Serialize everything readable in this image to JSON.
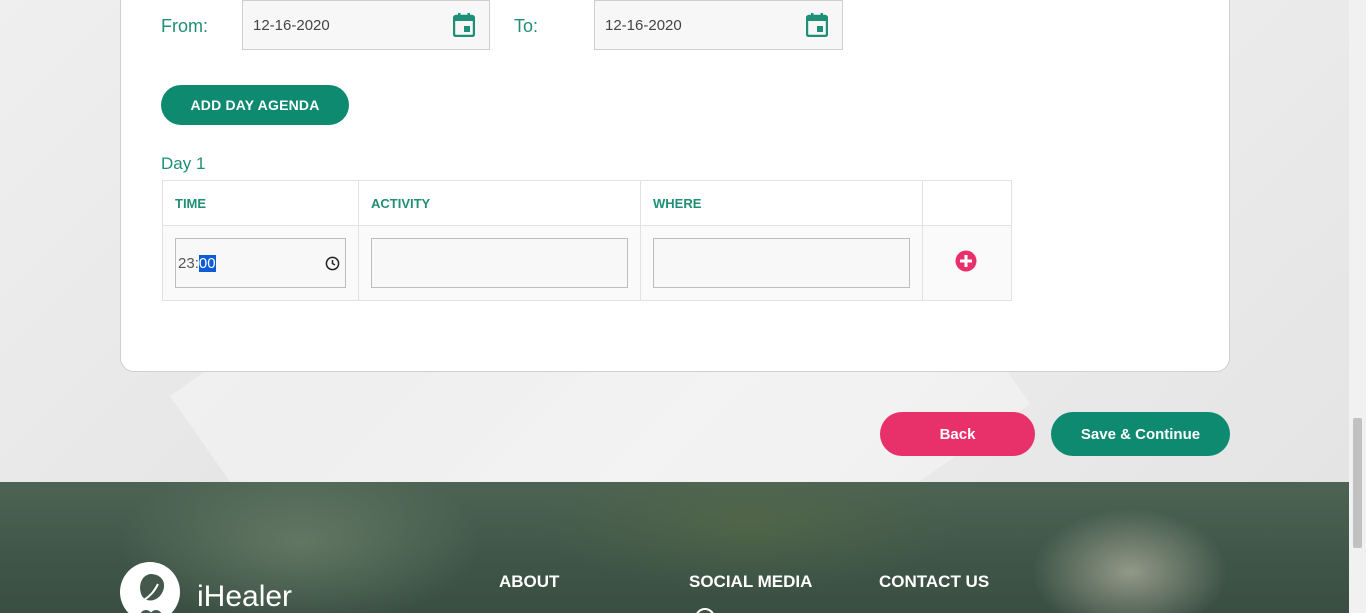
{
  "dates": {
    "from_label": "From:",
    "from_value": "12-16-2020",
    "to_label": "To:",
    "to_value": "12-16-2020"
  },
  "agenda": {
    "add_button": "ADD DAY AGENDA",
    "day_label": "Day 1",
    "columns": [
      "TIME",
      "ACTIVITY",
      "WHERE"
    ],
    "row": {
      "time_hours": "23",
      "time_sep": ":",
      "time_minutes": "00",
      "activity": "",
      "where": ""
    }
  },
  "actions": {
    "back": "Back",
    "save": "Save & Continue"
  },
  "footer": {
    "brand": "iHealer",
    "about": "ABOUT",
    "social": "SOCIAL MEDIA",
    "contact": "CONTACT US"
  },
  "colors": {
    "primary": "#0e8a70",
    "accent": "#e8306b",
    "label": "#1f8f77"
  }
}
